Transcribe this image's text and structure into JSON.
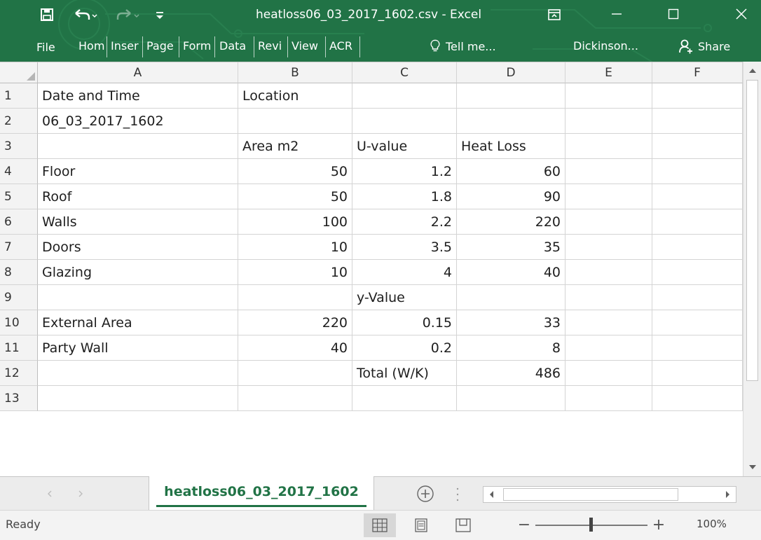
{
  "window": {
    "title": "heatloss06_03_2017_1602.csv - Excel",
    "accent": "#217346"
  },
  "quick_access": {
    "save": "save-icon",
    "undo": "undo-icon",
    "redo": "redo-icon",
    "customize": "customize-icon"
  },
  "ribbon": {
    "tabs": [
      "File",
      "Hom",
      "Inser",
      "Page",
      "Form",
      "Data",
      "Revi",
      "View",
      "ACR"
    ],
    "tell_me": "Tell me...",
    "account": "Dickinson...",
    "share": "Share"
  },
  "sheet": {
    "columns": [
      "A",
      "B",
      "C",
      "D",
      "E",
      "F"
    ],
    "rows": [
      {
        "num": "1",
        "cells": [
          "Date and Time",
          "Location",
          "",
          "",
          "",
          ""
        ]
      },
      {
        "num": "2",
        "cells": [
          "06_03_2017_1602",
          "",
          "",
          "",
          "",
          ""
        ]
      },
      {
        "num": "3",
        "cells": [
          "",
          "Area m2",
          "U-value",
          "Heat Loss",
          "",
          ""
        ]
      },
      {
        "num": "4",
        "cells": [
          "Floor",
          "50",
          "1.2",
          "60",
          "",
          ""
        ]
      },
      {
        "num": "5",
        "cells": [
          "Roof",
          "50",
          "1.8",
          "90",
          "",
          ""
        ]
      },
      {
        "num": "6",
        "cells": [
          "Walls",
          "100",
          "2.2",
          "220",
          "",
          ""
        ]
      },
      {
        "num": "7",
        "cells": [
          "Doors",
          "10",
          "3.5",
          "35",
          "",
          ""
        ]
      },
      {
        "num": "8",
        "cells": [
          "Glazing",
          "10",
          "4",
          "40",
          "",
          ""
        ]
      },
      {
        "num": "9",
        "cells": [
          "",
          "",
          "y-Value",
          "",
          "",
          ""
        ]
      },
      {
        "num": "10",
        "cells": [
          "External Area",
          "220",
          "0.15",
          "33",
          "",
          ""
        ]
      },
      {
        "num": "11",
        "cells": [
          "Party Wall",
          "40",
          "0.2",
          "8",
          "",
          ""
        ]
      },
      {
        "num": "12",
        "cells": [
          "",
          "",
          "Total (W/K)",
          "486",
          "",
          ""
        ]
      },
      {
        "num": "13",
        "cells": [
          "",
          "",
          "",
          "",
          "",
          ""
        ]
      }
    ]
  },
  "sheet_tabs": {
    "active": "heatloss06_03_2017_1602"
  },
  "status": {
    "text": "Ready",
    "zoom": "100%",
    "zoom_level": 100
  }
}
